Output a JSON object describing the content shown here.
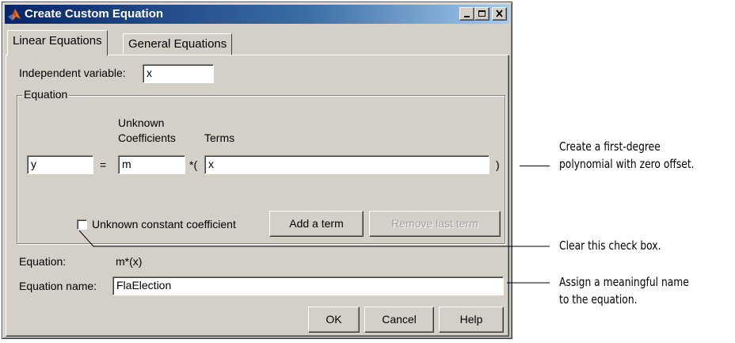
{
  "window": {
    "title": "Create Custom Equation",
    "logo_icon": "matlab-logo-icon",
    "controls": [
      "minimize",
      "maximize",
      "close"
    ]
  },
  "tabs": [
    {
      "label": "Linear Equations",
      "active": true
    },
    {
      "label": "General Equations",
      "active": false
    }
  ],
  "independent_variable": {
    "label": "Independent variable:",
    "value": "x"
  },
  "equation_group": {
    "legend": "Equation",
    "unknown_coefficients_header_line1": "Unknown",
    "unknown_coefficients_header_line2": "Coefficients",
    "terms_header": "Terms",
    "lhs_value": "y",
    "equals": "=",
    "coefficient_value": "m",
    "times_open": "*(",
    "term_value": "x",
    "close_paren": ")",
    "constant_checkbox": {
      "label": "Unknown constant coefficient",
      "checked": false
    },
    "add_term_button": "Add a term",
    "remove_term_button": "Remove last term"
  },
  "equation_preview": {
    "label": "Equation:",
    "value": "m*(x)"
  },
  "equation_name": {
    "label": "Equation name:",
    "value": "FlaElection"
  },
  "buttons": {
    "ok": "OK",
    "cancel": "Cancel",
    "help": "Help"
  },
  "callouts": {
    "first_line1": "Create a first-degree",
    "first_line2": "polynomial with zero offset.",
    "second": "Clear this check box.",
    "third_line1": "Assign a meaningful name",
    "third_line2": "to the equation."
  }
}
